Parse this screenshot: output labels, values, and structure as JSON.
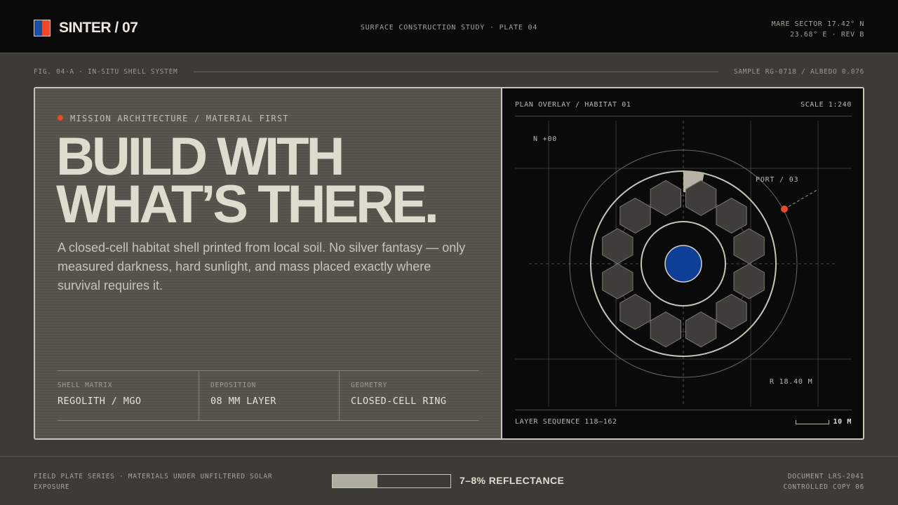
{
  "header": {
    "brand": "SINTER / 07",
    "center_title": "SURFACE CONSTRUCTION STUDY · PLATE 04",
    "coords_line1": "MARE SECTOR 17.42° N",
    "coords_line2": "23.68° E · REV B",
    "logo_colors": [
      "#1a4fa8",
      "#ea4a2a"
    ]
  },
  "figure": {
    "caption_left": "FIG. 04-A · IN-SITU SHELL SYSTEM",
    "caption_right": "SAMPLE RG-0718 / ALBEDO 0.076"
  },
  "hero": {
    "eyebrow": "MISSION ARCHITECTURE / MATERIAL FIRST",
    "headline_line1": "BUILD WITH",
    "headline_line2": "WHAT’S THERE.",
    "lede": "A closed-cell habitat shell printed from local soil. No silver fantasy — only measured darkness, hard sunlight, and mass placed exactly where survival requires it.",
    "accent_color": "#ea4a2a"
  },
  "specs": [
    {
      "label": "SHELL MATRIX",
      "value": "REGOLITH / MGO"
    },
    {
      "label": "DEPOSITION",
      "value": "08 MM LAYER"
    },
    {
      "label": "GEOMETRY",
      "value": "CLOSED-CELL RING"
    }
  ],
  "plan": {
    "title": "PLAN OVERLAY / HABITAT 01",
    "scale": "SCALE 1:240",
    "north_label": "N +00",
    "port_label": "PORT / 03",
    "radius_label": "R 18.40 M",
    "footer_left": "LAYER SEQUENCE 118–162",
    "scalebar_label": "10 M",
    "cell_count": 12,
    "core_color": "#0f3f96",
    "cell_color": "#3f3d39",
    "port_color": "#ea4a2a"
  },
  "footer": {
    "left_text": "FIELD PLATE SERIES · MATERIALS UNDER UNFILTERED SOLAR EXPOSURE",
    "meter_fraction": 0.38,
    "meter_label": "7–8% REFLECTANCE",
    "doc_line1": "DOCUMENT LRS-2041",
    "doc_line2": "CONTROLLED COPY 06"
  }
}
